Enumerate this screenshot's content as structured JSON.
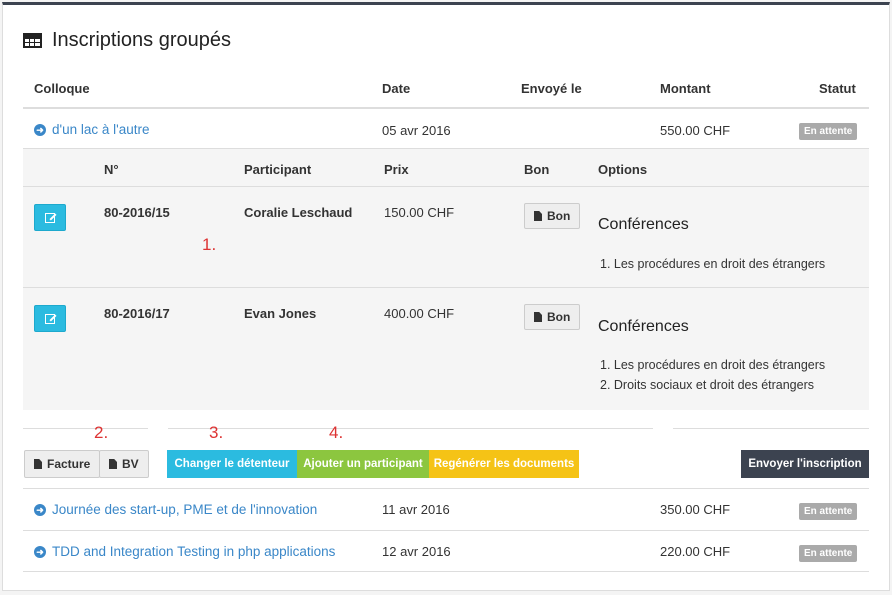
{
  "title": "Inscriptions groupés",
  "columns": {
    "colloque": "Colloque",
    "date": "Date",
    "envoye": "Envoyé le",
    "montant": "Montant",
    "statut": "Statut"
  },
  "rows": [
    {
      "name": "d'un lac à l'autre",
      "date": "05 avr 2016",
      "amount": "550.00 CHF",
      "status": "En attente"
    },
    {
      "name": "Journée des start-up, PME et de l'innovation",
      "date": "11 avr 2016",
      "amount": "350.00 CHF",
      "status": "En attente"
    },
    {
      "name": "TDD and Integration Testing in php applications",
      "date": "12 avr 2016",
      "amount": "220.00 CHF",
      "status": "En attente"
    }
  ],
  "subcolumns": {
    "num": "N°",
    "participant": "Participant",
    "prix": "Prix",
    "bon": "Bon",
    "options": "Options"
  },
  "participants": [
    {
      "num": "80-2016/15",
      "name": "Coralie Leschaud",
      "price": "150.00 CHF",
      "bon": "Bon",
      "options_title": "Conférences",
      "options": [
        "Les procédures en droit des étrangers"
      ]
    },
    {
      "num": "80-2016/17",
      "name": "Evan Jones",
      "price": "400.00 CHF",
      "bon": "Bon",
      "options_title": "Conférences",
      "options": [
        "Les procédures en droit des étrangers",
        "Droits sociaux et droit des étrangers"
      ]
    }
  ],
  "annotations": [
    "1.",
    "2.",
    "3.",
    "4."
  ],
  "buttons": {
    "facture": "Facture",
    "bv": "BV",
    "changer": "Changer le détenteur",
    "ajouter": "Ajouter un participant",
    "regenerer": "Regénérer les documents",
    "envoyer": "Envoyer l'inscription"
  },
  "colors": {
    "link": "#3a87c8",
    "info": "#2bbbe0",
    "success": "#8cc63f",
    "warning": "#f5c316",
    "dark": "#3c4350"
  }
}
